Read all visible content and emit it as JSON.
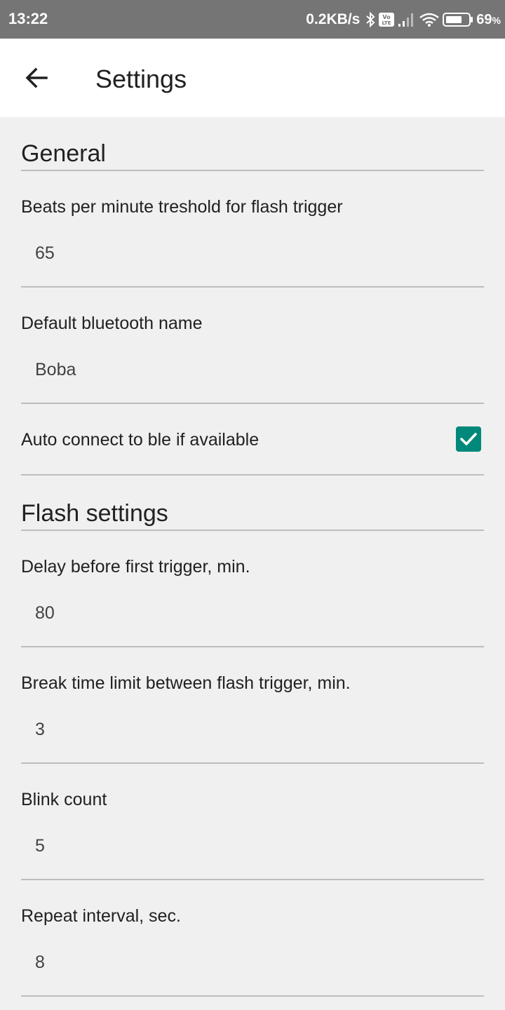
{
  "status_bar": {
    "time": "13:22",
    "network_speed": "0.2KB/s",
    "battery_percent": "69",
    "battery_unit": "%",
    "icons": [
      "bluetooth-icon",
      "volte-icon",
      "signal-icon",
      "wifi-icon",
      "battery-icon"
    ]
  },
  "app_bar": {
    "title": "Settings",
    "back_icon": "arrow-back-icon"
  },
  "categories": [
    {
      "title": "General",
      "items": [
        {
          "type": "edit",
          "label": "Beats per minute treshold for flash trigger",
          "value": "65"
        },
        {
          "type": "edit",
          "label": "Default bluetooth name",
          "value": "Boba"
        },
        {
          "type": "checkbox",
          "label": "Auto connect to ble if available",
          "checked": true
        }
      ]
    },
    {
      "title": "Flash settings",
      "items": [
        {
          "type": "edit",
          "label": "Delay before first trigger, min.",
          "value": "80"
        },
        {
          "type": "edit",
          "label": "Break time limit between flash trigger, min.",
          "value": "3"
        },
        {
          "type": "edit",
          "label": "Blink count",
          "value": "5"
        },
        {
          "type": "edit",
          "label": "Repeat interval, sec.",
          "value": "8"
        }
      ]
    }
  ],
  "colors": {
    "status_bar": "#757575",
    "app_bar": "#ffffff",
    "background": "#f0f0f0",
    "accent": "#00897b",
    "divider": "#bdbdbd"
  }
}
